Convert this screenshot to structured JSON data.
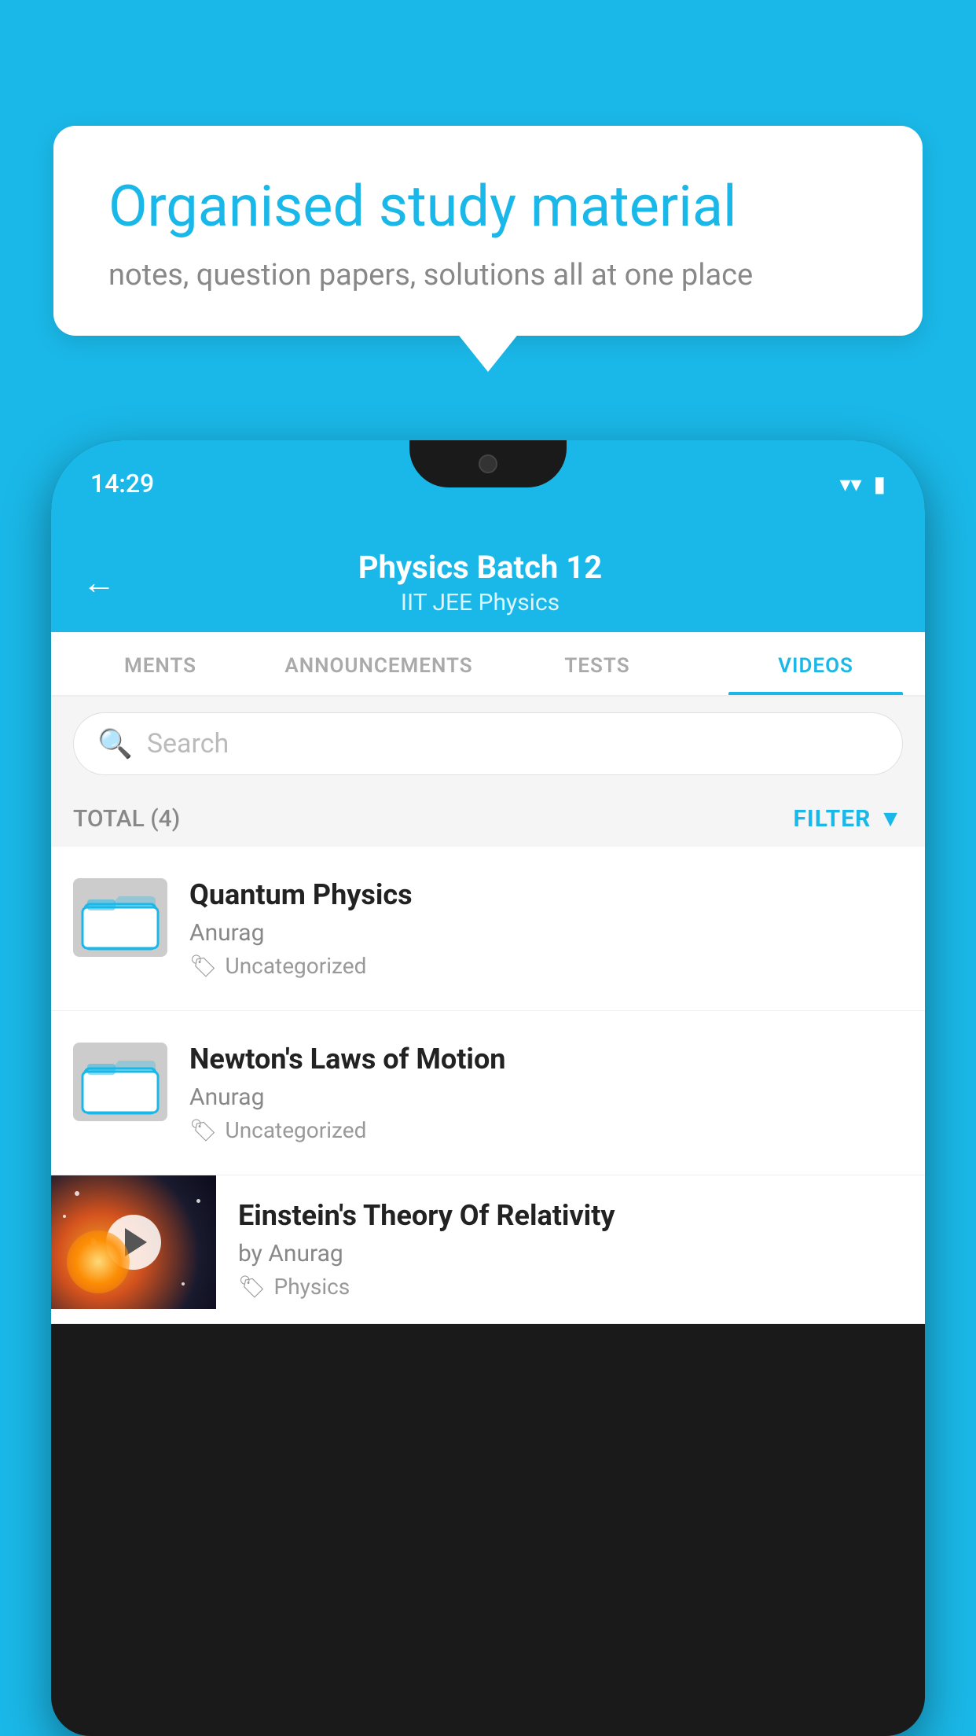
{
  "background_color": "#1ab8e8",
  "speech_bubble": {
    "title": "Organised study material",
    "subtitle": "notes, question papers, solutions all at one place"
  },
  "status_bar": {
    "time": "14:29",
    "wifi_icon": "▼",
    "signal_icon": "▲",
    "battery_icon": "▮"
  },
  "app_header": {
    "back_label": "←",
    "title": "Physics Batch 12",
    "subtitle": "IIT JEE   Physics"
  },
  "tabs": [
    {
      "label": "MENTS",
      "active": false
    },
    {
      "label": "ANNOUNCEMENTS",
      "active": false
    },
    {
      "label": "TESTS",
      "active": false
    },
    {
      "label": "VIDEOS",
      "active": true
    }
  ],
  "search": {
    "placeholder": "Search"
  },
  "filter_bar": {
    "total_label": "TOTAL (4)",
    "filter_label": "FILTER"
  },
  "videos": [
    {
      "title": "Quantum Physics",
      "author": "Anurag",
      "tag": "Uncategorized",
      "has_thumbnail": false
    },
    {
      "title": "Newton's Laws of Motion",
      "author": "Anurag",
      "tag": "Uncategorized",
      "has_thumbnail": false
    },
    {
      "title": "Einstein's Theory Of Relativity",
      "author": "by Anurag",
      "tag": "Physics",
      "has_thumbnail": true
    }
  ]
}
